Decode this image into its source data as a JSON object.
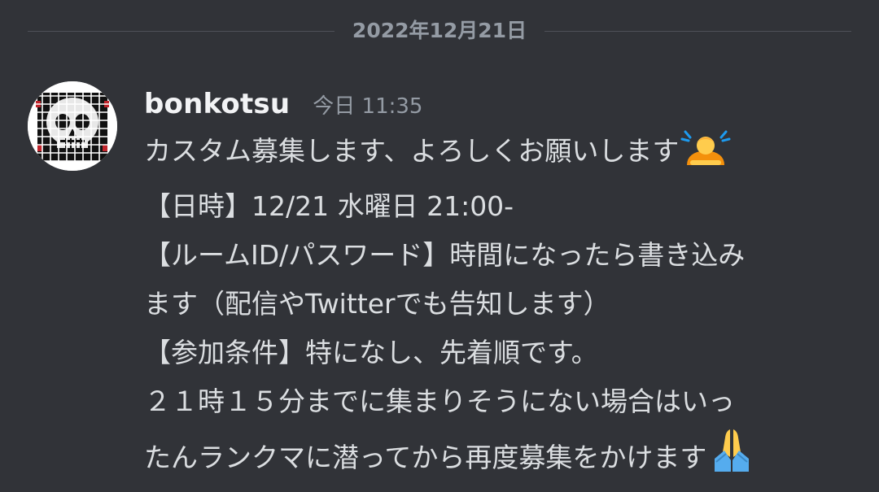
{
  "divider": {
    "date": "2022年12月21日"
  },
  "message": {
    "username": "bonkotsu",
    "timestamp": "今日 11:35",
    "avatar_icon": "skull-grid-avatar",
    "lines": [
      "カスタム募集します、よろしくお願いします",
      "【日時】12/21 水曜日 21:00-",
      "【ルームID/パスワード】時間になったら書き込み",
      "ます（配信やTwitterでも告知します）",
      "【参加条件】特になし、先着順です。",
      "２１時１５分までに集まりそうにない場合はいっ",
      "たんランクマに潜ってから再度募集をかけます"
    ],
    "emojis": {
      "line_1": "person-bowing-emoji",
      "line_7": "folded-hands-emoji"
    }
  },
  "colors": {
    "background": "#313338",
    "username": "#f2f3f5",
    "text": "#dbdee1",
    "muted": "#949ba4",
    "divider": "#4e5058"
  }
}
